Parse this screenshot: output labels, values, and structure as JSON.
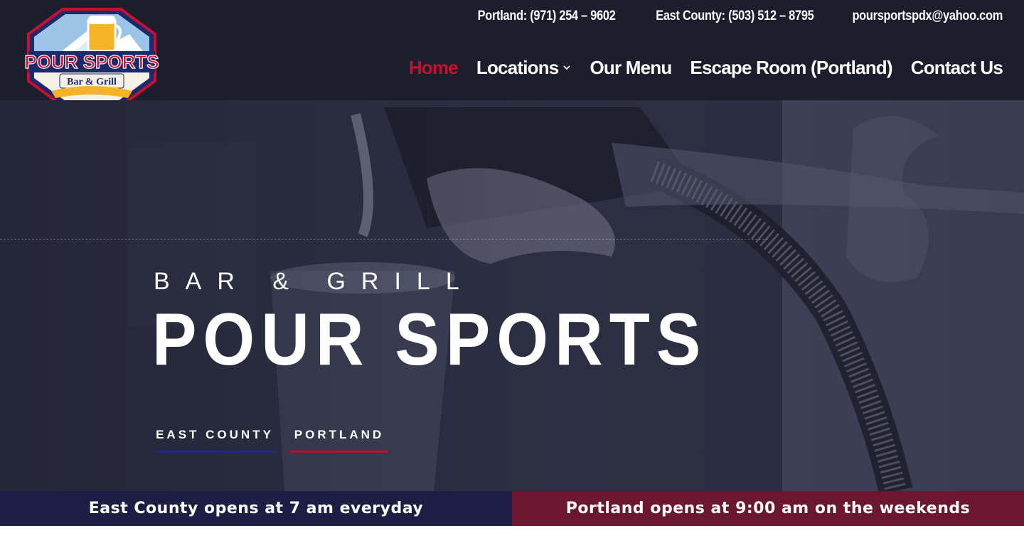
{
  "site": {
    "logo": {
      "main_text": "POUR SPORTS",
      "sub_text": "Bar & Grill"
    }
  },
  "topbar": {
    "portland_phone": "Portland: (971) 254 – 9602",
    "east_county_phone": "East County: (503) 512 – 8795",
    "email": "poursportspdx@yahoo.com"
  },
  "nav": {
    "items": [
      {
        "label": "Home",
        "active": true
      },
      {
        "label": "Locations",
        "has_dropdown": true
      },
      {
        "label": "Our Menu"
      },
      {
        "label": "Escape Room (Portland)"
      },
      {
        "label": "Contact Us"
      }
    ]
  },
  "hero": {
    "subtitle": "BAR & GRILL",
    "title": "POUR SPORTS",
    "buttons": {
      "east_county": "EAST COUNTY",
      "portland": "PORTLAND"
    }
  },
  "banners": {
    "left": "East County opens at 7 am everyday",
    "right": "Portland opens at 9:00 am on the weekends"
  },
  "colors": {
    "header_bg": "#1c1e2d",
    "active_nav": "#c8102e",
    "banner_left_bg": "#1c1e45",
    "banner_right_bg": "#6b1730",
    "east_county_underline": "#1f2a7a",
    "portland_underline": "#b3122f"
  }
}
